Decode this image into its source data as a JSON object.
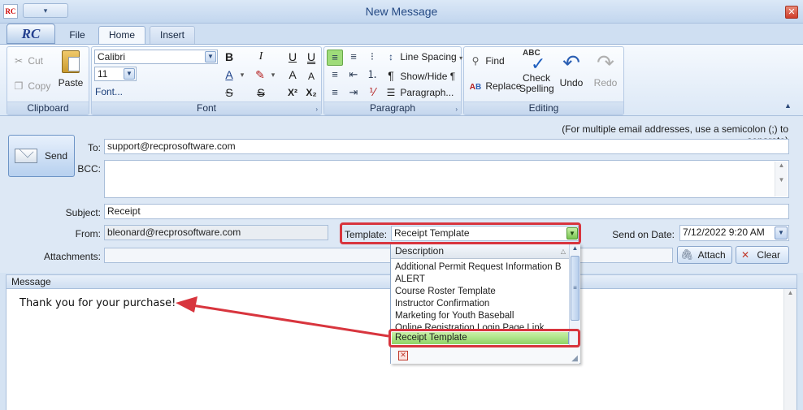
{
  "window": {
    "title": "New Message",
    "app_logo": "RC",
    "qat_glyph": "▾",
    "close_glyph": "✕",
    "app_icon_text": "RC"
  },
  "tabs": [
    {
      "label": "File"
    },
    {
      "label": "Home"
    },
    {
      "label": "Insert"
    }
  ],
  "ribbon": {
    "clipboard": {
      "label": "Clipboard",
      "cut": "Cut",
      "copy": "Copy",
      "paste": "Paste"
    },
    "font": {
      "label": "Font",
      "family": "Calibri",
      "size": "11",
      "font_dialog": "Font...",
      "bold": "B",
      "italic": "I",
      "underline": "U",
      "underline_alt": "U",
      "superscript": "X²",
      "subscript": "X₂",
      "strikethrough": "S",
      "strike_alt": "S",
      "grow": "A",
      "shrink": "A",
      "font_color": "A"
    },
    "paragraph": {
      "label": "Paragraph",
      "line_spacing": "Line Spacing",
      "show_hide": "Show/Hide ¶",
      "paragraph": "Paragraph..."
    },
    "editing": {
      "label": "Editing",
      "find": "Find",
      "replace": "Replace",
      "check_spelling_line1": "Check",
      "check_spelling_line2": "Spelling",
      "undo": "Undo",
      "redo": "Redo",
      "spell_icon_text": "ABC"
    }
  },
  "form": {
    "hint": "(For multiple email addresses, use a semicolon (;) to separate)",
    "send_label": "Send",
    "to_label": "To:",
    "to_value": "support@recprosoftware.com",
    "bcc_label": "BCC:",
    "bcc_value": "",
    "subject_label": "Subject:",
    "subject_value": "Receipt",
    "from_label": "From:",
    "from_value": "bleonard@recprosoftware.com",
    "template_label": "Template:",
    "template_value": "Receipt Template",
    "send_on_date_label": "Send on Date:",
    "send_on_date_value": "7/12/2022 9:20 AM",
    "attachments_label": "Attachments:",
    "attach_label": "Attach",
    "clear_label": "Clear"
  },
  "message": {
    "header": "Message",
    "body": "Thank you for your purchase!"
  },
  "template_dropdown": {
    "column_header": "Description",
    "items": [
      "Additional Permit Request Information B...",
      "ALERT",
      "Course Roster Template",
      "Instructor Confirmation",
      "Marketing for Youth Baseball",
      "Online Registration Login Page Link",
      "Receipt Template"
    ],
    "selected": "Receipt Template"
  },
  "colors": {
    "highlight_green": "#9fdc7a",
    "annotation_red": "#d8353e",
    "accent_blue": "#254a84"
  }
}
